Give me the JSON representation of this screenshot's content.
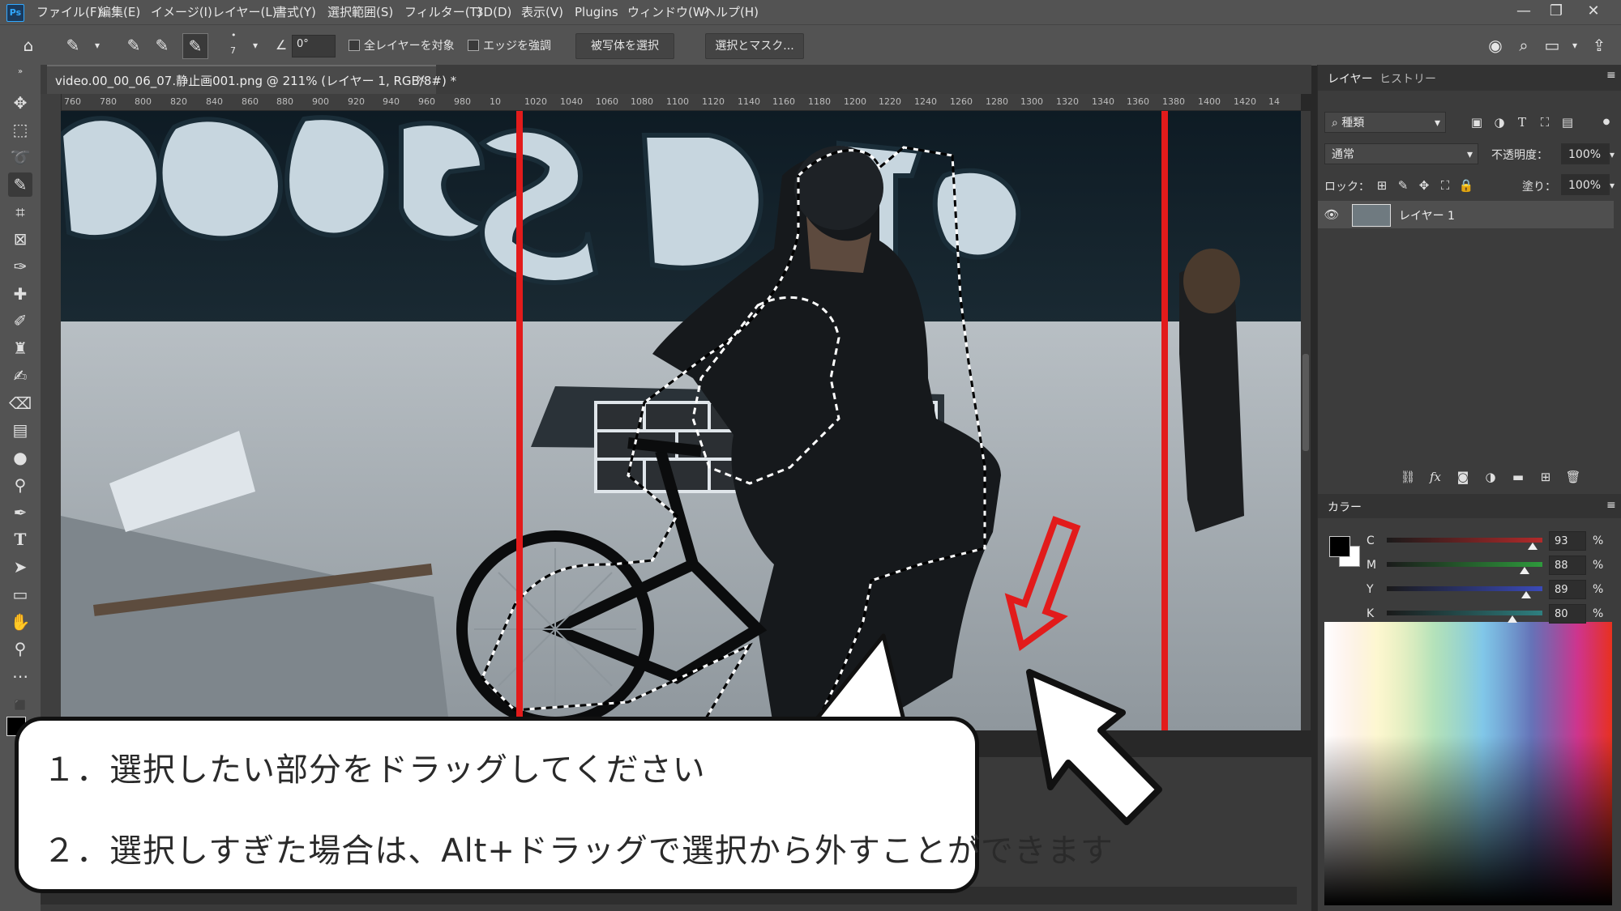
{
  "menubar": {
    "logo": "Ps",
    "items": [
      "ファイル(F)",
      "編集(E)",
      "イメージ(I)",
      "レイヤー(L)",
      "書式(Y)",
      "選択範囲(S)",
      "フィルター(T)",
      "3D(D)",
      "表示(V)",
      "Plugins",
      "ウィンドウ(W)",
      "ヘルプ(H)"
    ],
    "window_controls": [
      "—",
      "❐",
      "✕"
    ]
  },
  "options": {
    "brush_size": "7",
    "angle": "0°",
    "sample_all_layers": "全レイヤーを対象",
    "enhance_edge": "エッジを強調",
    "select_subject": "被写体を選択",
    "select_and_mask": "選択とマスク..."
  },
  "document": {
    "tab_title": "video.00_00_06_07.静止画001.png @ 211% (レイヤー 1, RGB/8#) *",
    "close": "×",
    "ruler_ticks": [
      "760",
      "780",
      "800",
      "820",
      "840",
      "860",
      "880",
      "900",
      "920",
      "940",
      "960",
      "980",
      "10",
      "1020",
      "1040",
      "1060",
      "1080",
      "1100",
      "1120",
      "1140",
      "1160",
      "1180",
      "1200",
      "1220",
      "1240",
      "1260",
      "1280",
      "1300",
      "1320",
      "1340",
      "1360",
      "1380",
      "1400",
      "1420",
      "14"
    ]
  },
  "layers_panel": {
    "tabs": [
      "レイヤー",
      "ヒストリー"
    ],
    "filter_kind": "種類",
    "blend_mode": "通常",
    "opacity_label": "不透明度：",
    "opacity_value": "100%",
    "lock_label": "ロック：",
    "fill_label": "塗り：",
    "fill_value": "100%",
    "layer_name": "レイヤー 1"
  },
  "color_panel": {
    "title": "カラー",
    "channels": [
      {
        "label": "C",
        "value": "93",
        "unit": "%",
        "level": 0.93,
        "color": "#b22a2a"
      },
      {
        "label": "M",
        "value": "88",
        "unit": "%",
        "level": 0.88,
        "color": "#2e9a3c"
      },
      {
        "label": "Y",
        "value": "89",
        "unit": "%",
        "level": 0.89,
        "color": "#3a4ab8"
      },
      {
        "label": "K",
        "value": "80",
        "unit": "%",
        "level": 0.8,
        "color": "#2e7f7f"
      }
    ]
  },
  "callout": {
    "line1": "１．選択したい部分をドラッグしてください",
    "line2": "２．選択しすぎた場合は、Alt+ドラッグで選択から外すことができます"
  },
  "colors": {
    "highlight_red": "#e21b1b",
    "panel_bg": "#3c3c3c",
    "bar_bg": "#535353"
  }
}
